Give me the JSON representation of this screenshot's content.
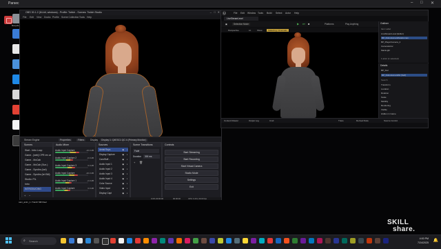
{
  "outer_window": {
    "title": "Parsec"
  },
  "desktop_icons": [
    {
      "label": "Recycle Bin"
    },
    {
      "label": ""
    },
    {
      "label": ""
    },
    {
      "label": ""
    },
    {
      "label": ""
    },
    {
      "label": ""
    },
    {
      "label": ""
    },
    {
      "label": ""
    },
    {
      "label": ""
    }
  ],
  "desktop_bottom_icons": [
    {
      "label": "sam_anim_1..."
    },
    {
      "label": "Tranch MR Reel..."
    }
  ],
  "obs": {
    "title": "OBS 30.1.2 (64-bit, windows) - Profile: Twitch - Scenes: Twitch Studio",
    "menu": [
      "File",
      "Edit",
      "View",
      "Docks",
      "Profile",
      "Scene Collection",
      "Tools",
      "Help"
    ],
    "source_bar": {
      "source": "Stream Engine",
      "properties": "Properties",
      "filters": "Filters",
      "display_label": "Display",
      "display_value": "Display 1: Q4E3C1 QC 4 (Primary Monitor)"
    },
    "scenes": {
      "title": "Scenes",
      "items": [
        "Start - Intro Loop",
        "Game - [web] CPR rev web",
        "Game - MoCab",
        "Game - MoCab (Sun.)",
        "Game - Syndirs (tort)",
        "Game - Syndirs (bri BM)",
        "Studio: PIL",
        "Intro",
        "INTRODUCING"
      ],
      "selected": 8
    },
    "audio_mixer": {
      "title": "Audio Mixer",
      "channels": [
        {
          "name": "Audio Input Capture",
          "db": "-16.0 dB",
          "level": 0.72
        },
        {
          "name": "Audio Input Capture 2",
          "db": "-0.0 dB",
          "level": 0.55
        },
        {
          "name": "Audio Input Capture 3",
          "db": "0.0 dB",
          "level": 0.6
        },
        {
          "name": "Audio Input Capture",
          "db": "-20.0 dB",
          "level": 0.68
        },
        {
          "name": "Audio Input Capture 1",
          "db": "-2.0 dB",
          "level": 0.5
        },
        {
          "name": "Audio Input Capture",
          "db": "0.0 dB",
          "level": 0.45
        }
      ]
    },
    "sources": {
      "title": "Sources",
      "items": [
        "Aerial Rays",
        "Display Capture",
        "Cam/Buff...",
        "Audio Input 1",
        "Audio Input 2",
        "Audio Input 3",
        "Audio Input 4",
        "Color Source",
        "Video Input",
        "Display Capt"
      ],
      "selected": 0
    },
    "transitions": {
      "title": "Scene Transitions",
      "type_value": "Fade",
      "duration_label": "Duration",
      "duration_value": "300 ms"
    },
    "controls": {
      "title": "Controls",
      "buttons": [
        "Start Streaming",
        "Start Recording",
        "Start Virtual Camera",
        "Studio Mode",
        "Settings",
        "Exit"
      ]
    },
    "status": {
      "left": "0.0% 00:00:00",
      "mid": "00:00:00",
      "right": "CPU: 0.4%, 60.00 fps"
    }
  },
  "ue": {
    "menu": [
      "File",
      "Edit",
      "Window",
      "Tools",
      "Build",
      "Select",
      "Actor",
      "Help"
    ],
    "tab": "LiveStreamLevel",
    "toolbar": {
      "mode": "Selection Mode",
      "platforms": "Platforms",
      "plus": "Play Anything"
    },
    "viewport_bar": [
      "Perspective",
      "Lit",
      "Show",
      "Stateiring: Cinematic"
    ],
    "bottom": [
      "Content Drawer",
      "Output Log",
      "Cmd",
      "Trace",
      "Derived Data",
      "Source Control"
    ],
    "outliner": {
      "title": "Outliner",
      "rows": [
        "Item Label",
        "LiveStreamLevel (Editor)",
        "BP_RoboHumanMetaHuman",
        "BP_PlayerCamera_2",
        "CameraActor",
        "MainLight"
      ],
      "selected": 2,
      "count": "1 actor (1 selected)"
    },
    "details": {
      "title": "Details",
      "actor": "BP_Kiel",
      "component": "BP_RoboHumanMH (Self)",
      "rows": [
        "Search",
        "Transform",
        "Location",
        "Rotation",
        "Scale",
        "Mobility",
        "Rendering",
        "Visible",
        "Hidden in Game",
        "Editor Billboard"
      ]
    }
  },
  "taskbar": {
    "search_placeholder": "Search",
    "time": "4:00 PM",
    "date": "7/24/2025"
  },
  "watermark": {
    "line1": "SKILL",
    "line2": "share."
  }
}
